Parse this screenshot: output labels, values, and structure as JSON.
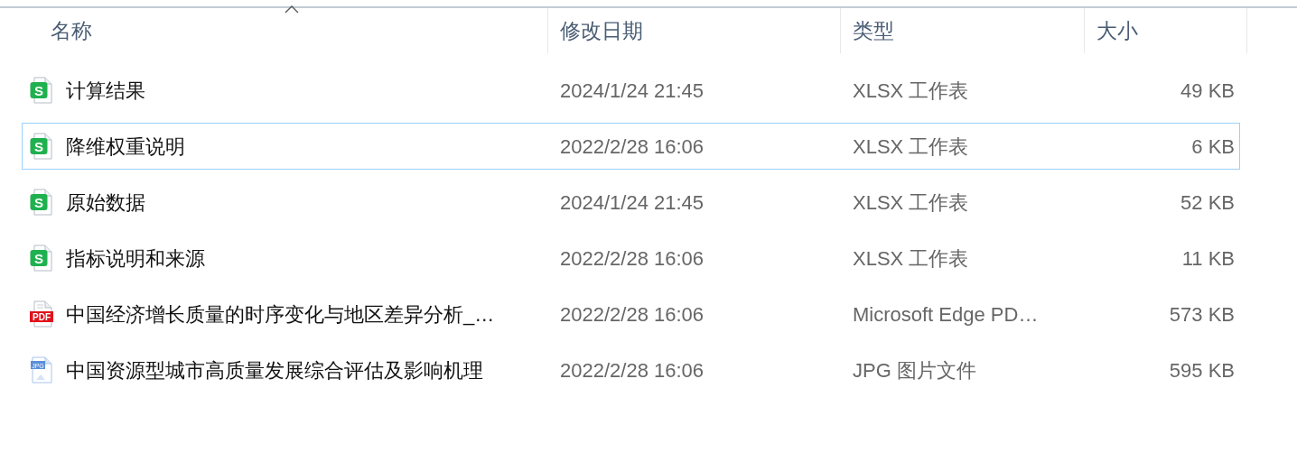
{
  "columns": [
    {
      "label": "名称",
      "sorted": true
    },
    {
      "label": "修改日期",
      "sorted": false
    },
    {
      "label": "类型",
      "sorted": false
    },
    {
      "label": "大小",
      "sorted": false
    }
  ],
  "files": [
    {
      "kind": "xlsx",
      "icon_label": "S",
      "name": "计算结果",
      "modified": "2024/1/24 21:45",
      "type": "XLSX 工作表",
      "size": "49 KB",
      "focused": false
    },
    {
      "kind": "xlsx",
      "icon_label": "S",
      "name": "降维权重说明",
      "modified": "2022/2/28 16:06",
      "type": "XLSX 工作表",
      "size": "6 KB",
      "focused": true
    },
    {
      "kind": "xlsx",
      "icon_label": "S",
      "name": "原始数据",
      "modified": "2024/1/24 21:45",
      "type": "XLSX 工作表",
      "size": "52 KB",
      "focused": false
    },
    {
      "kind": "xlsx",
      "icon_label": "S",
      "name": "指标说明和来源",
      "modified": "2022/2/28 16:06",
      "type": "XLSX 工作表",
      "size": "11 KB",
      "focused": false
    },
    {
      "kind": "pdf",
      "icon_label": "PDF",
      "name": "中国经济增长质量的时序变化与地区差异分析_…",
      "modified": "2022/2/28 16:06",
      "type": "Microsoft Edge PD…",
      "size": "573 KB",
      "focused": false
    },
    {
      "kind": "jpg",
      "icon_label": "JPG",
      "name": "中国资源型城市高质量发展综合评估及影响机理",
      "modified": "2022/2/28 16:06",
      "type": "JPG 图片文件",
      "size": "595 KB",
      "focused": false
    }
  ]
}
